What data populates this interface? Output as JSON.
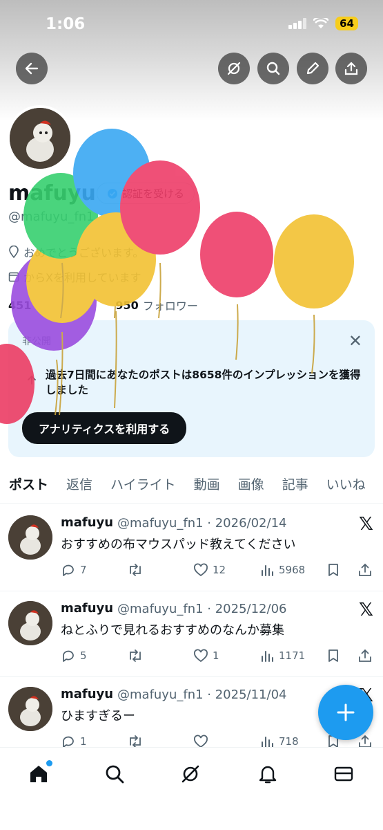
{
  "status": {
    "time": "1:06",
    "battery": "64"
  },
  "header": {
    "buttons": [
      "back",
      "grok",
      "search",
      "edit",
      "share"
    ]
  },
  "profile": {
    "name": "mafuyu",
    "verify_label": "認証を受ける",
    "handle": "@mafuyu_fn1",
    "bio": "おめでとうございます。",
    "joined": "からXを利用しています",
    "following_count": "451",
    "followers_count": "950",
    "followers_label": "フォロワー"
  },
  "private_card": {
    "label": "非公開",
    "text": "過去7日間にあなたのポストは8658件のインプレッションを獲得しました",
    "button": "アナリティクスを利用する"
  },
  "tabs": [
    "ポスト",
    "返信",
    "ハイライト",
    "動画",
    "画像",
    "記事",
    "いいね"
  ],
  "posts": [
    {
      "name": "mafuyu",
      "meta": "@mafuyu_fn1 · 2026/02/14",
      "text": "おすすめの布マウスパッド教えてください",
      "replies": "7",
      "retweets": "",
      "likes": "12",
      "views": "5968"
    },
    {
      "name": "mafuyu",
      "meta": "@mafuyu_fn1 · 2025/12/06",
      "text": "ねとふりで見れるおすすめのなんか募集",
      "replies": "5",
      "retweets": "",
      "likes": "1",
      "views": "1171"
    },
    {
      "name": "mafuyu",
      "meta": "@mafuyu_fn1 · 2025/11/04",
      "text": "ひますぎるー",
      "replies": "1",
      "retweets": "",
      "likes": "",
      "views": "718"
    }
  ],
  "colors": {
    "accent": "#1d9bf0",
    "text": "#0f1419",
    "muted": "#536471"
  }
}
